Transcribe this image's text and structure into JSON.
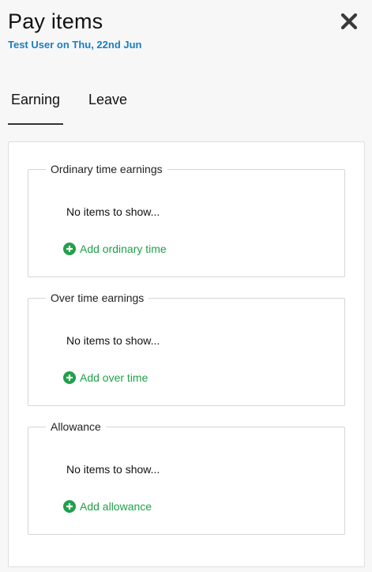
{
  "header": {
    "title": "Pay items",
    "subtitle": "Test User on Thu, 22nd Jun",
    "close_icon": "close-icon"
  },
  "tabs": [
    {
      "label": "Earning",
      "active": true
    },
    {
      "label": "Leave",
      "active": false
    }
  ],
  "groups": [
    {
      "title": "Ordinary time earnings",
      "empty_text": "No items to show...",
      "add_label": "Add ordinary time",
      "add_icon": "plus-circle-icon"
    },
    {
      "title": "Over time earnings",
      "empty_text": "No items to show...",
      "add_label": "Add over time",
      "add_icon": "plus-circle-icon"
    },
    {
      "title": "Allowance",
      "empty_text": "No items to show...",
      "add_label": "Add allowance",
      "add_icon": "plus-circle-icon"
    }
  ],
  "colors": {
    "accent_blue": "#1a7fc1",
    "add_green": "#20a04a"
  }
}
